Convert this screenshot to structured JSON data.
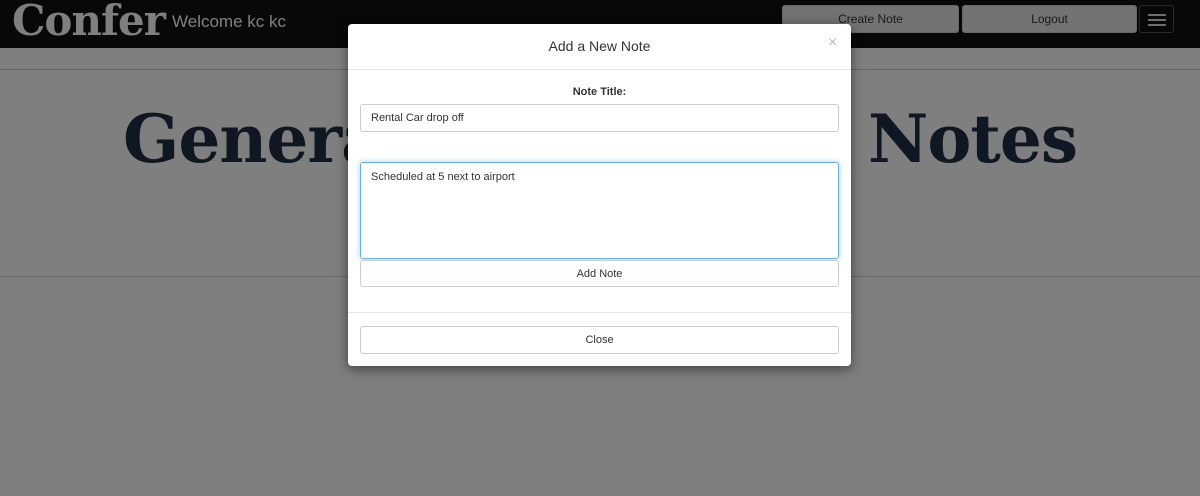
{
  "navbar": {
    "brand": "Confer",
    "welcome": "Welcome kc kc",
    "create_note_label": "Create Note",
    "logout_label": "Logout",
    "menu_icon": "hamburger-icon"
  },
  "page": {
    "heading": "General Community Notes"
  },
  "modal": {
    "title": "Add a New Note",
    "close_symbol": "×",
    "note_title_label": "Note Title:",
    "note_title_value": "Rental Car drop off",
    "note_body_value": "Scheduled at 5 next to airport",
    "add_note_label": "Add Note",
    "close_label": "Close"
  }
}
